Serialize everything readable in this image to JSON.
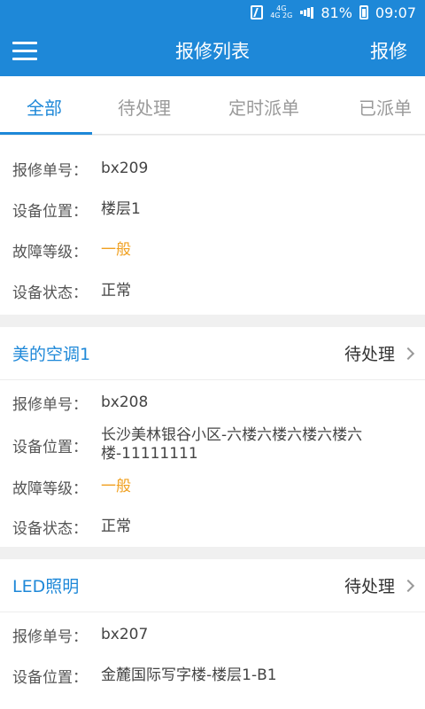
{
  "status_bar": {
    "network_top": "4G",
    "network_mid": "4G",
    "network_bottom": "2G",
    "battery": "81%",
    "time": "09:07"
  },
  "header": {
    "title": "报修列表",
    "action": "报修"
  },
  "tabs": [
    {
      "label": "全部",
      "active": true
    },
    {
      "label": "待处理",
      "active": false
    },
    {
      "label": "定时派单",
      "active": false
    },
    {
      "label": "已派单",
      "active": false
    }
  ],
  "labels": {
    "order_no": "报修单号：",
    "location": "设备位置：",
    "level": "故障等级：",
    "status": "设备状态："
  },
  "cards": [
    {
      "order_no": "bx209",
      "location": "楼层1",
      "level": "一般",
      "status": "正常"
    },
    {
      "name": "美的空调1",
      "state": "待处理",
      "order_no": "bx208",
      "location": "长沙美林银谷小区-六楼六楼六楼六楼六楼-11111111",
      "level": "一般",
      "status": "正常"
    },
    {
      "name": "LED照明",
      "state": "待处理",
      "order_no": "bx207",
      "location": "金麓国际写字楼-楼层1-B1"
    }
  ],
  "colors": {
    "primary": "#1e88d8",
    "warning": "#f0a020"
  }
}
